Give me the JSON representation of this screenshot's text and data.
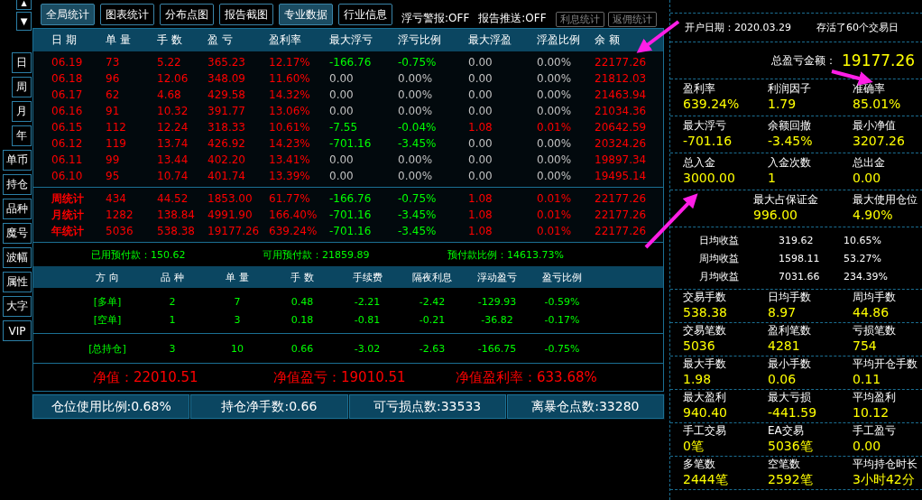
{
  "sidebar": {
    "scroll_buttons": [
      "▲",
      "▼"
    ],
    "periods": [
      "日",
      "周",
      "月",
      "年"
    ],
    "views": [
      "单币",
      "持仓",
      "品种",
      "魔号",
      "波幅",
      "属性",
      "大字",
      "VIP"
    ]
  },
  "toolbar": {
    "buttons": [
      {
        "label": "全局统计",
        "selected": true
      },
      {
        "label": "图表统计",
        "selected": false
      },
      {
        "label": "分布点图",
        "selected": false
      },
      {
        "label": "报告截图",
        "selected": false
      },
      {
        "label": "专业数据",
        "selected": true
      },
      {
        "label": "行业信息",
        "selected": false
      }
    ],
    "info": [
      "浮亏警报:OFF",
      "报告推送:OFF"
    ],
    "small_buttons": [
      "利息统计",
      "返佣统计"
    ]
  },
  "daily": {
    "columns": [
      "日 期",
      "单 量",
      "手 数",
      "盈 亏",
      "盈利率",
      "最大浮亏",
      "浮亏比例",
      "最大浮盈",
      "浮盈比例",
      "余 额"
    ],
    "rows": [
      [
        {
          "text": "06.19",
          "color": "#ff0000"
        },
        {
          "text": "73",
          "color": "#ff0000"
        },
        {
          "text": "5.22",
          "color": "#ff0000"
        },
        {
          "text": "365.23",
          "color": "#ff0000"
        },
        {
          "text": "12.17%",
          "color": "#ff0000"
        },
        {
          "text": "-166.76",
          "color": "#00ff00"
        },
        {
          "text": "-0.75%",
          "color": "#00ff00"
        },
        {
          "text": "0.00",
          "color": "#c0c0c0"
        },
        {
          "text": "0.00%",
          "color": "#c0c0c0"
        },
        {
          "text": "22177.26",
          "color": "#ff0000"
        }
      ],
      [
        {
          "text": "06.18",
          "color": "#ff0000"
        },
        {
          "text": "96",
          "color": "#ff0000"
        },
        {
          "text": "12.06",
          "color": "#ff0000"
        },
        {
          "text": "348.09",
          "color": "#ff0000"
        },
        {
          "text": "11.60%",
          "color": "#ff0000"
        },
        {
          "text": "0.00",
          "color": "#c0c0c0"
        },
        {
          "text": "0.00%",
          "color": "#c0c0c0"
        },
        {
          "text": "0.00",
          "color": "#c0c0c0"
        },
        {
          "text": "0.00%",
          "color": "#c0c0c0"
        },
        {
          "text": "21812.03",
          "color": "#ff0000"
        }
      ],
      [
        {
          "text": "06.17",
          "color": "#ff0000"
        },
        {
          "text": "62",
          "color": "#ff0000"
        },
        {
          "text": "4.68",
          "color": "#ff0000"
        },
        {
          "text": "429.58",
          "color": "#ff0000"
        },
        {
          "text": "14.32%",
          "color": "#ff0000"
        },
        {
          "text": "0.00",
          "color": "#c0c0c0"
        },
        {
          "text": "0.00%",
          "color": "#c0c0c0"
        },
        {
          "text": "0.00",
          "color": "#c0c0c0"
        },
        {
          "text": "0.00%",
          "color": "#c0c0c0"
        },
        {
          "text": "21463.94",
          "color": "#ff0000"
        }
      ],
      [
        {
          "text": "06.16",
          "color": "#ff0000"
        },
        {
          "text": "91",
          "color": "#ff0000"
        },
        {
          "text": "10.32",
          "color": "#ff0000"
        },
        {
          "text": "391.77",
          "color": "#ff0000"
        },
        {
          "text": "13.06%",
          "color": "#ff0000"
        },
        {
          "text": "0.00",
          "color": "#c0c0c0"
        },
        {
          "text": "0.00%",
          "color": "#c0c0c0"
        },
        {
          "text": "0.00",
          "color": "#c0c0c0"
        },
        {
          "text": "0.00%",
          "color": "#c0c0c0"
        },
        {
          "text": "21034.36",
          "color": "#ff0000"
        }
      ],
      [
        {
          "text": "06.15",
          "color": "#ff0000"
        },
        {
          "text": "112",
          "color": "#ff0000"
        },
        {
          "text": "12.24",
          "color": "#ff0000"
        },
        {
          "text": "318.33",
          "color": "#ff0000"
        },
        {
          "text": "10.61%",
          "color": "#ff0000"
        },
        {
          "text": "-7.55",
          "color": "#00ff00"
        },
        {
          "text": "-0.04%",
          "color": "#00ff00"
        },
        {
          "text": "1.08",
          "color": "#ff0000"
        },
        {
          "text": "0.01%",
          "color": "#ff0000"
        },
        {
          "text": "20642.59",
          "color": "#ff0000"
        }
      ],
      [
        {
          "text": "06.12",
          "color": "#ff0000"
        },
        {
          "text": "119",
          "color": "#ff0000"
        },
        {
          "text": "13.74",
          "color": "#ff0000"
        },
        {
          "text": "426.92",
          "color": "#ff0000"
        },
        {
          "text": "14.23%",
          "color": "#ff0000"
        },
        {
          "text": "-701.16",
          "color": "#00ff00"
        },
        {
          "text": "-3.45%",
          "color": "#00ff00"
        },
        {
          "text": "0.00",
          "color": "#c0c0c0"
        },
        {
          "text": "0.00%",
          "color": "#c0c0c0"
        },
        {
          "text": "20324.26",
          "color": "#ff0000"
        }
      ],
      [
        {
          "text": "06.11",
          "color": "#ff0000"
        },
        {
          "text": "99",
          "color": "#ff0000"
        },
        {
          "text": "13.44",
          "color": "#ff0000"
        },
        {
          "text": "402.20",
          "color": "#ff0000"
        },
        {
          "text": "13.41%",
          "color": "#ff0000"
        },
        {
          "text": "0.00",
          "color": "#c0c0c0"
        },
        {
          "text": "0.00%",
          "color": "#c0c0c0"
        },
        {
          "text": "0.00",
          "color": "#c0c0c0"
        },
        {
          "text": "0.00%",
          "color": "#c0c0c0"
        },
        {
          "text": "19897.34",
          "color": "#ff0000"
        }
      ],
      [
        {
          "text": "06.10",
          "color": "#ff0000"
        },
        {
          "text": "95",
          "color": "#ff0000"
        },
        {
          "text": "10.74",
          "color": "#ff0000"
        },
        {
          "text": "401.74",
          "color": "#ff0000"
        },
        {
          "text": "13.39%",
          "color": "#ff0000"
        },
        {
          "text": "0.00",
          "color": "#c0c0c0"
        },
        {
          "text": "0.00%",
          "color": "#c0c0c0"
        },
        {
          "text": "0.00",
          "color": "#c0c0c0"
        },
        {
          "text": "0.00%",
          "color": "#c0c0c0"
        },
        {
          "text": "19495.14",
          "color": "#ff0000"
        }
      ]
    ],
    "totals": [
      [
        {
          "text": "周统计",
          "color": "#ff0000"
        },
        {
          "text": "434",
          "color": "#ff0000"
        },
        {
          "text": "44.52",
          "color": "#ff0000"
        },
        {
          "text": "1853.00",
          "color": "#ff0000"
        },
        {
          "text": "61.77%",
          "color": "#ff0000"
        },
        {
          "text": "-166.76",
          "color": "#00ff00"
        },
        {
          "text": "-0.75%",
          "color": "#00ff00"
        },
        {
          "text": "1.08",
          "color": "#ff0000"
        },
        {
          "text": "0.01%",
          "color": "#ff0000"
        },
        {
          "text": "22177.26",
          "color": "#ff0000"
        }
      ],
      [
        {
          "text": "月统计",
          "color": "#ff0000"
        },
        {
          "text": "1282",
          "color": "#ff0000"
        },
        {
          "text": "138.84",
          "color": "#ff0000"
        },
        {
          "text": "4991.90",
          "color": "#ff0000"
        },
        {
          "text": "166.40%",
          "color": "#ff0000"
        },
        {
          "text": "-701.16",
          "color": "#00ff00"
        },
        {
          "text": "-3.45%",
          "color": "#00ff00"
        },
        {
          "text": "1.08",
          "color": "#ff0000"
        },
        {
          "text": "0.01%",
          "color": "#ff0000"
        },
        {
          "text": "22177.26",
          "color": "#ff0000"
        }
      ],
      [
        {
          "text": "年统计",
          "color": "#ff0000"
        },
        {
          "text": "5036",
          "color": "#ff0000"
        },
        {
          "text": "538.38",
          "color": "#ff0000"
        },
        {
          "text": "19177.26",
          "color": "#ff0000"
        },
        {
          "text": "639.24%",
          "color": "#ff0000"
        },
        {
          "text": "-701.16",
          "color": "#00ff00"
        },
        {
          "text": "-3.45%",
          "color": "#00ff00"
        },
        {
          "text": "1.08",
          "color": "#ff0000"
        },
        {
          "text": "0.01%",
          "color": "#ff0000"
        },
        {
          "text": "22177.26",
          "color": "#ff0000"
        }
      ]
    ]
  },
  "margin_summary": [
    "已用预付款：150.62",
    "可用预付款：21859.89",
    "预付款比例：14613.73%"
  ],
  "positions": {
    "columns": [
      "方 向",
      "品 种",
      "单 量",
      "手 数",
      "手续费",
      "隔夜利息",
      "浮动盈亏",
      "盈亏比例"
    ],
    "rows": [
      [
        "[多单]",
        "2",
        "7",
        "0.48",
        "-2.21",
        "-2.42",
        "-129.93",
        "-0.59%"
      ],
      [
        "[空单]",
        "1",
        "3",
        "0.18",
        "-0.81",
        "-0.21",
        "-36.82",
        "-0.17%"
      ]
    ],
    "total": [
      "[总持仓]",
      "3",
      "10",
      "0.66",
      "-3.02",
      "-2.63",
      "-166.75",
      "-0.75%"
    ]
  },
  "net": [
    "净值：22010.51",
    "净值盈亏：19010.51",
    "净值盈利率：633.68%"
  ],
  "footer_buttons": [
    "仓位使用比例:0.68%",
    "持仓净手数:0.66",
    "可亏损点数:33533",
    "离暴仓点数:33280"
  ],
  "summary": [
    {
      "kind": "info",
      "items": [
        "开户日期：2020.03.29",
        "存活了60个交易日"
      ]
    },
    {
      "kind": "total",
      "label": "总盈亏金额：",
      "value": "19177.26"
    },
    {
      "kind": "stats",
      "items": [
        {
          "label": "盈利率",
          "value": "639.24%"
        },
        {
          "label": "利润因子",
          "value": "1.79"
        },
        {
          "label": "准确率",
          "value": "85.01%"
        }
      ]
    },
    {
      "kind": "stats",
      "items": [
        {
          "label": "最大浮亏",
          "value": "-701.16"
        },
        {
          "label": "余额回撤",
          "value": "-3.45%"
        },
        {
          "label": "最小净值",
          "value": "3207.26"
        }
      ]
    },
    {
      "kind": "stats",
      "items": [
        {
          "label": "总入金",
          "value": "3000.00"
        },
        {
          "label": "入金次数",
          "value": "1"
        },
        {
          "label": "总出金",
          "value": "0.00"
        }
      ]
    },
    {
      "kind": "pair",
      "items": [
        {
          "label": "最大占保证金",
          "value": "996.00"
        },
        {
          "label": "最大使用仓位",
          "value": "4.90%"
        }
      ]
    },
    {
      "kind": "averages",
      "rows": [
        [
          "日均收益",
          "319.62",
          "10.65%"
        ],
        [
          "周均收益",
          "1598.11",
          "53.27%"
        ],
        [
          "月均收益",
          "7031.66",
          "234.39%"
        ]
      ]
    },
    {
      "kind": "stats",
      "items": [
        {
          "label": "交易手数",
          "value": "538.38"
        },
        {
          "label": "日均手数",
          "value": "8.97"
        },
        {
          "label": "周均手数",
          "value": "44.86"
        }
      ]
    },
    {
      "kind": "stats",
      "items": [
        {
          "label": "交易笔数",
          "value": "5036"
        },
        {
          "label": "盈利笔数",
          "value": "4281"
        },
        {
          "label": "亏损笔数",
          "value": "754"
        }
      ]
    },
    {
      "kind": "stats",
      "items": [
        {
          "label": "最大手数",
          "value": "1.98"
        },
        {
          "label": "最小手数",
          "value": "0.06"
        },
        {
          "label": "平均开仓手数",
          "value": "0.11"
        }
      ]
    },
    {
      "kind": "stats",
      "items": [
        {
          "label": "最大盈利",
          "value": "940.40"
        },
        {
          "label": "最大亏损",
          "value": "-441.59"
        },
        {
          "label": "平均盈利",
          "value": "10.12"
        }
      ]
    },
    {
      "kind": "stats",
      "items": [
        {
          "label": "手工交易",
          "value": "0笔"
        },
        {
          "label": "EA交易",
          "value": "5036笔"
        },
        {
          "label": "手工盈亏",
          "value": "0.00"
        }
      ]
    },
    {
      "kind": "stats",
      "items": [
        {
          "label": "多笔数",
          "value": "2444笔"
        },
        {
          "label": "空笔数",
          "value": "2592笔"
        },
        {
          "label": "平均持仓时长",
          "value": "3小时42分"
        }
      ]
    }
  ]
}
